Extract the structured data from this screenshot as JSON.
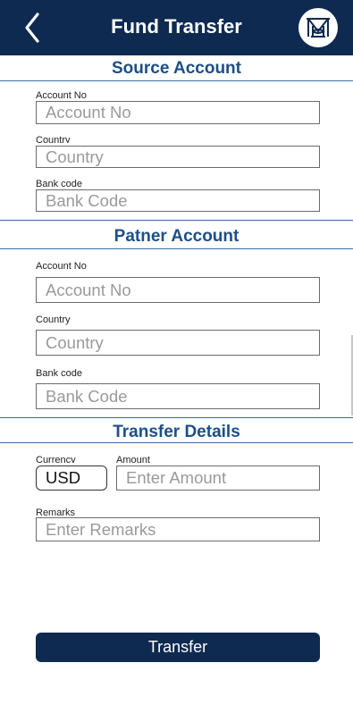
{
  "header": {
    "title": "Fund Transfer",
    "back_icon": "chevron-left-icon",
    "logo_text": "MB"
  },
  "source_account": {
    "title": "Source Account",
    "account_no_label": "Account No",
    "account_no_placeholder": "Account No",
    "country_label": "Country",
    "country_placeholder": "Country",
    "bank_code_label": "Bank code",
    "bank_code_placeholder": "Bank Code"
  },
  "partner_account": {
    "title": "Patner Account",
    "account_no_label": "Account No",
    "account_no_placeholder": "Account No",
    "country_label": "Country",
    "country_placeholder": "Country",
    "bank_code_label": "Bank code",
    "bank_code_placeholder": "Bank Code"
  },
  "transfer_details": {
    "title": "Transfer Details",
    "currency_label": "Currency",
    "currency_value": "USD",
    "amount_label": "Amount",
    "amount_placeholder": "Enter Amount",
    "remarks_label": "Remarks",
    "remarks_placeholder": "Enter Remarks"
  },
  "actions": {
    "transfer_label": "Transfer"
  },
  "colors": {
    "primary": "#0e2a50",
    "section_title": "#1d4f86"
  }
}
